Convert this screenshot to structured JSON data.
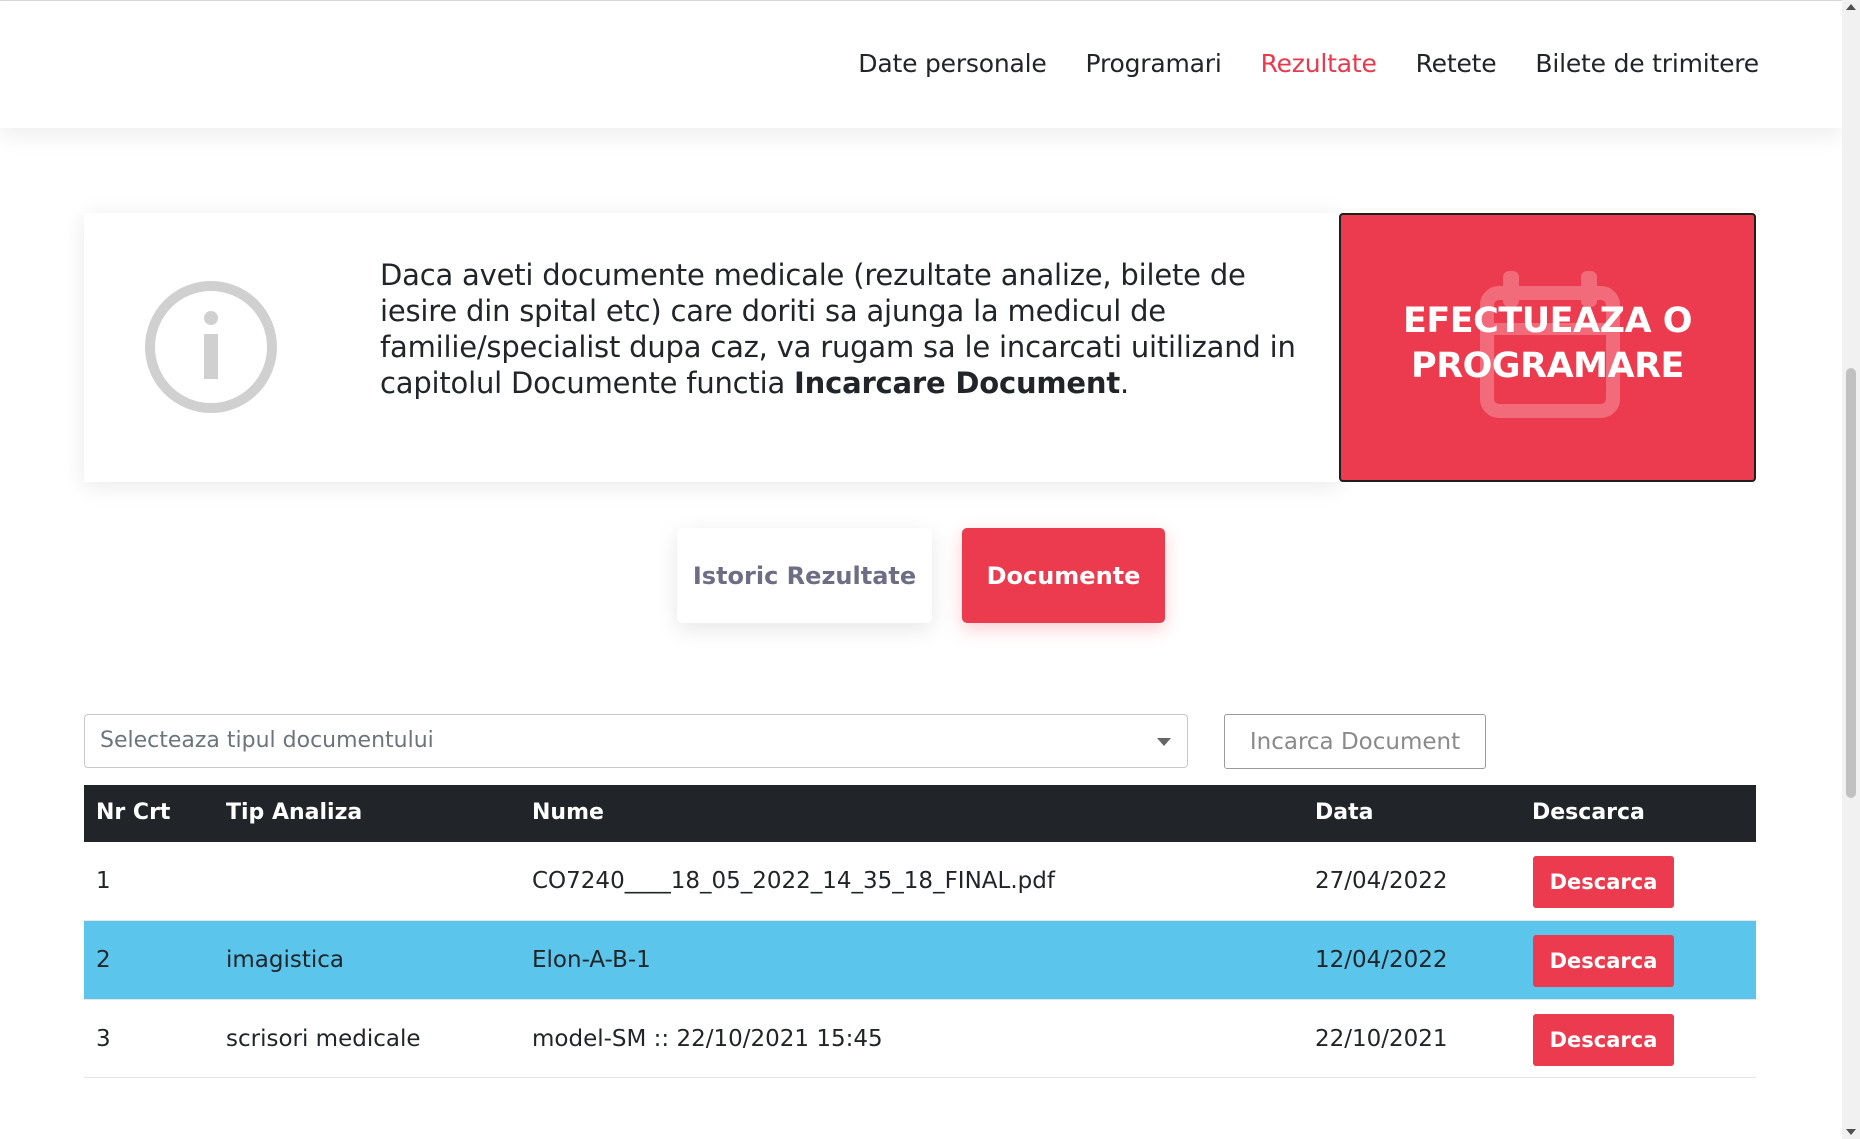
{
  "nav": {
    "items": [
      {
        "label": "Date personale",
        "active": false
      },
      {
        "label": "Programari",
        "active": false
      },
      {
        "label": "Rezultate",
        "active": true
      },
      {
        "label": "Retete",
        "active": false
      },
      {
        "label": "Bilete de trimitere",
        "active": false
      }
    ]
  },
  "info": {
    "text_before": "Daca aveti documente medicale (rezultate analize, bilete de iesire din spital etc) care doriti sa ajunga la medicul de familie/specialist dupa caz, va rugam sa le incarcati uitilizand in capitolul Documente functia ",
    "text_bold": "Incarcare Document",
    "text_after": "."
  },
  "cta": {
    "label": "EFECTUEAZA O PROGRAMARE"
  },
  "tabs": {
    "istoric": "Istoric Rezultate",
    "documente": "Documente"
  },
  "filter": {
    "select_placeholder": "Selecteaza tipul documentului",
    "upload_label": "Incarca Document"
  },
  "table": {
    "headers": [
      "Nr Crt",
      "Tip Analiza",
      "Nume",
      "Data",
      "Descarca"
    ],
    "rows": [
      {
        "nr": "1",
        "tip": "",
        "nume": "CO7240____18_05_2022_14_35_18_FINAL.pdf",
        "data": "27/04/2022",
        "action": "Descarca",
        "highlight": false
      },
      {
        "nr": "2",
        "tip": "imagistica",
        "nume": "Elon-A-B-1",
        "data": "12/04/2022",
        "action": "Descarca",
        "highlight": true
      },
      {
        "nr": "3",
        "tip": "scrisori medicale",
        "nume": "model-SM :: 22/10/2021 15:45",
        "data": "22/10/2021",
        "action": "Descarca",
        "highlight": false
      }
    ]
  },
  "colors": {
    "accent": "#ec3b4f",
    "highlight_row": "#5bc5ec",
    "table_header": "#212529"
  },
  "icons": {
    "info": "info-circle-icon",
    "cta_background": "calendar-icon"
  }
}
